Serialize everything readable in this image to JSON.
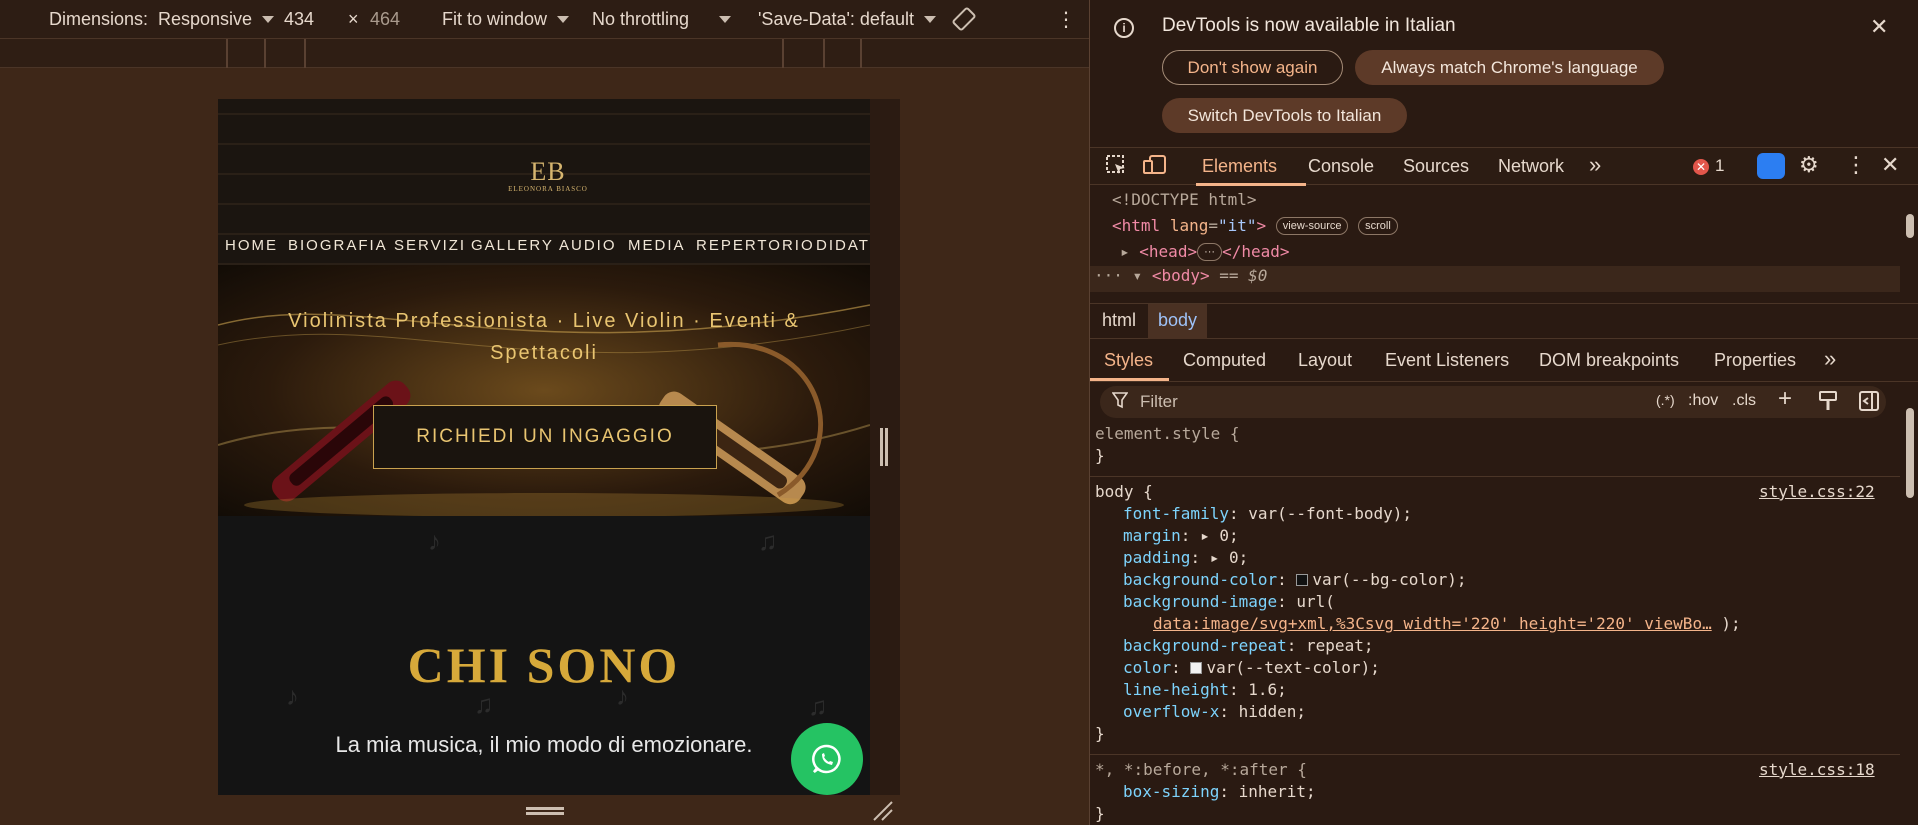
{
  "device_toolbar": {
    "dimensions_label": "Dimensions:",
    "preset": "Responsive",
    "width": "434",
    "times": "×",
    "height": "464",
    "zoom": "Fit to window",
    "throttling": "No throttling",
    "save_data": "'Save-Data': default"
  },
  "site": {
    "logo_monogram": "EB",
    "logo_name": "ELEONORA BIASCO",
    "nav": [
      "HOME",
      "BIOGRAFIA",
      "SERVIZI",
      "GALLERY",
      "AUDIO",
      "MEDIA",
      "REPERTORIO",
      "DIDAT"
    ],
    "hero_line1": "Violinista Professionista · Live Violin · Eventi &",
    "hero_line2": "Spettacoli",
    "cta": "RICHIEDI UN INGAGGIO",
    "about_title": "CHI SONO",
    "about_sub": "La mia musica, il mio modo di emozionare."
  },
  "infobar": {
    "message": "DevTools is now available in Italian",
    "btn_dont_show": "Don't show again",
    "btn_match": "Always match Chrome's language",
    "btn_switch": "Switch DevTools to Italian"
  },
  "devtools_tabs": {
    "elements": "Elements",
    "console": "Console",
    "sources": "Sources",
    "network": "Network",
    "more": "»",
    "error_count": "1"
  },
  "dom": {
    "doctype": "<!DOCTYPE html>",
    "html_open": "<html",
    "lang_attr": "lang",
    "lang_val": "\"it\"",
    "html_close_bracket": ">",
    "badge_view_source": "view-source",
    "badge_scroll": "scroll",
    "head_open": "<head>",
    "ellipsis": "···",
    "head_close": "</head>",
    "body_tag": "<body>",
    "body_eq": "== $0"
  },
  "breadcrumbs": [
    "html",
    "body"
  ],
  "styles_tabs": [
    "Styles",
    "Computed",
    "Layout",
    "Event Listeners",
    "DOM breakpoints",
    "Properties"
  ],
  "filter": {
    "placeholder": "Filter",
    "regex": "(.*)",
    "hov": ":hov",
    "cls": ".cls"
  },
  "css": {
    "element_style": "element.style {",
    "close": "}",
    "body_selector": "body {",
    "body_source": "style.css:22",
    "decls": [
      {
        "p": "font-family",
        "v": "var(--font-body);"
      },
      {
        "p": "margin",
        "v": "0;"
      },
      {
        "p": "padding",
        "v": "0;"
      },
      {
        "p": "background-color",
        "v": "var(--bg-color);"
      },
      {
        "p": "background-image",
        "v": "url("
      },
      {
        "p": "background-repeat",
        "v": "repeat;"
      },
      {
        "p": "color",
        "v": "var(--text-color);"
      },
      {
        "p": "line-height",
        "v": "1.6;"
      },
      {
        "p": "overflow-x",
        "v": "hidden;"
      }
    ],
    "url_value": "data:image/svg+xml,%3Csvg width='220' height='220' viewBo…",
    "url_close": ");",
    "universal_selector": "*, *:before, *:after {",
    "universal_source": "style.css:18",
    "box_sizing_p": "box-sizing",
    "box_sizing_v": "inherit;"
  },
  "colors": {
    "accent": "#f4b48a",
    "gold": "#d7a93a",
    "whatsapp": "#25c363",
    "error": "#e2564b"
  }
}
